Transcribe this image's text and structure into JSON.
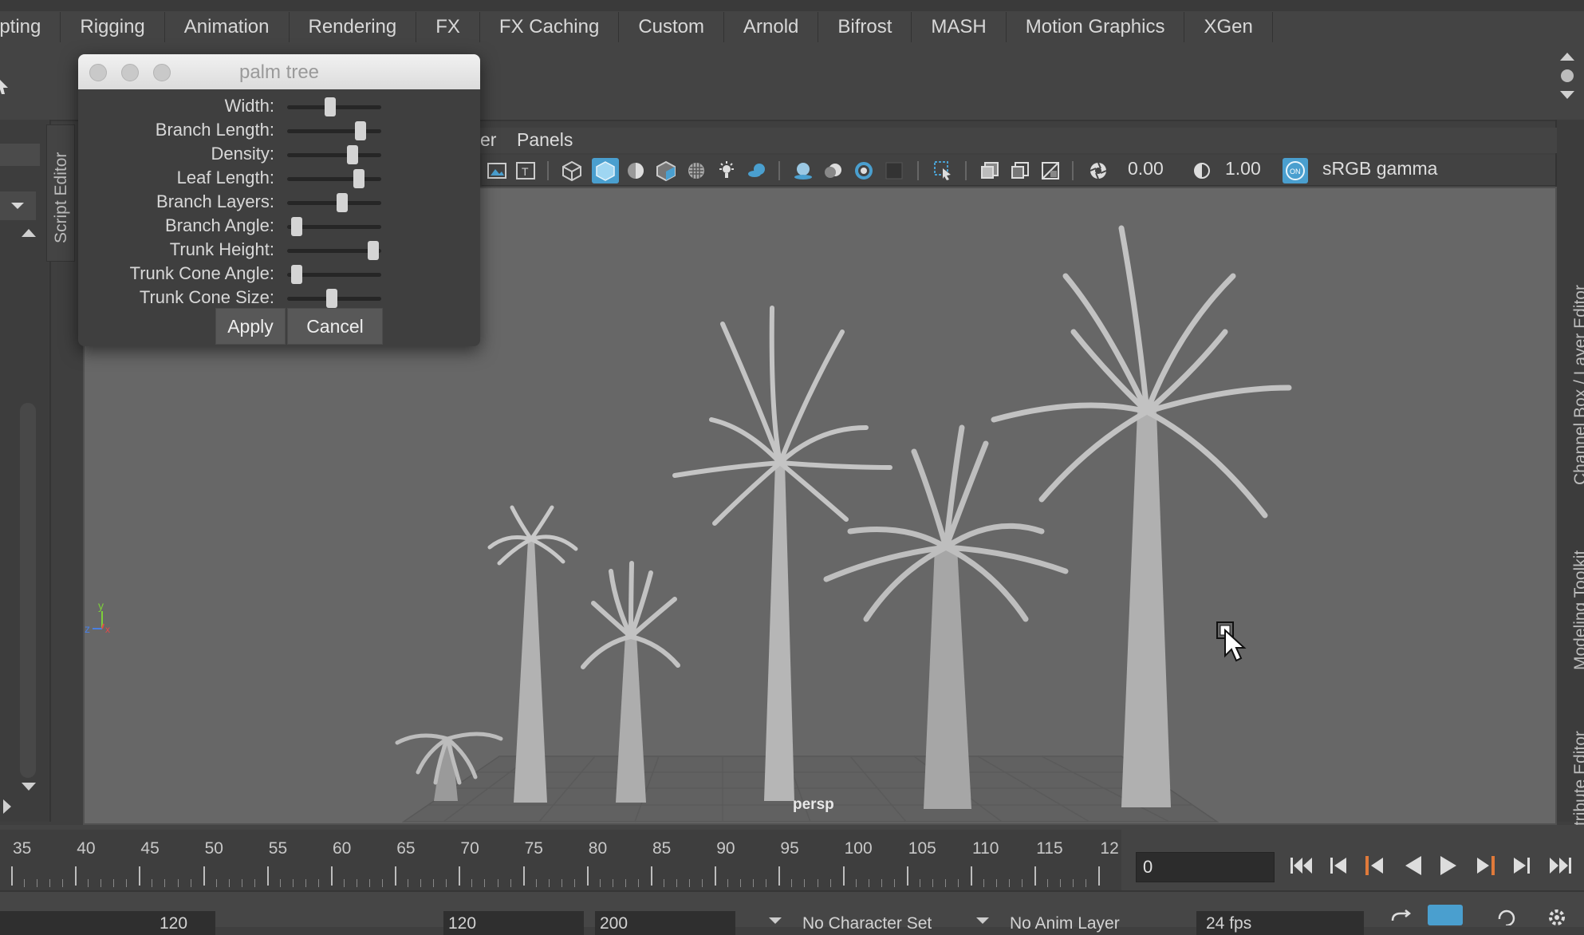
{
  "shelf_tabs": [
    "lpting",
    "Rigging",
    "Animation",
    "Rendering",
    "FX",
    "FX Caching",
    "Custom",
    "Arnold",
    "Bifrost",
    "MASH",
    "Motion Graphics",
    "XGen"
  ],
  "side_tabs": {
    "left": "Script Editor",
    "right_channel": "Channel Box / Layer Editor",
    "right_modeling": "Modeling Toolkit",
    "right_attribute": "Attribute Editor"
  },
  "panel_menu": {
    "partial": "er",
    "panels": "Panels"
  },
  "viewport_toolbar": {
    "exposure": "0.00",
    "gamma": "1.00",
    "color_space": "sRGB gamma",
    "on_badge": "ON"
  },
  "viewport": {
    "camera_label": "persp",
    "axis_y": "y",
    "axis_z": "z",
    "axis_x": "x"
  },
  "dialog": {
    "title": "palm tree",
    "sliders": [
      {
        "label": "Width:",
        "value": 0.45
      },
      {
        "label": "Branch Length:",
        "value": 0.82
      },
      {
        "label": "Density:",
        "value": 0.72
      },
      {
        "label": "Leaf Length:",
        "value": 0.8
      },
      {
        "label": "Branch Layers:",
        "value": 0.6
      },
      {
        "label": "Branch Angle:",
        "value": 0.05
      },
      {
        "label": "Trunk Height:",
        "value": 0.97
      },
      {
        "label": "Trunk Cone Angle:",
        "value": 0.05
      },
      {
        "label": "Trunk Cone Size:",
        "value": 0.47
      }
    ],
    "apply": "Apply",
    "cancel": "Cancel"
  },
  "timeline": {
    "tick_labels": [
      "35",
      "40",
      "45",
      "50",
      "55",
      "60",
      "65",
      "70",
      "75",
      "80",
      "85",
      "90",
      "95",
      "100",
      "105",
      "110",
      "115",
      "12"
    ],
    "current_frame": "0"
  },
  "bottom_bar": {
    "range_a": "120",
    "range_b": "120",
    "range_c": "200",
    "character_set": "No Character Set",
    "anim_layer": "No Anim Layer",
    "fps": "24 fps"
  },
  "colors": {
    "accent_blue": "#4a9fcf",
    "viewport_bg": "#676767",
    "ui_bg": "#444444"
  }
}
